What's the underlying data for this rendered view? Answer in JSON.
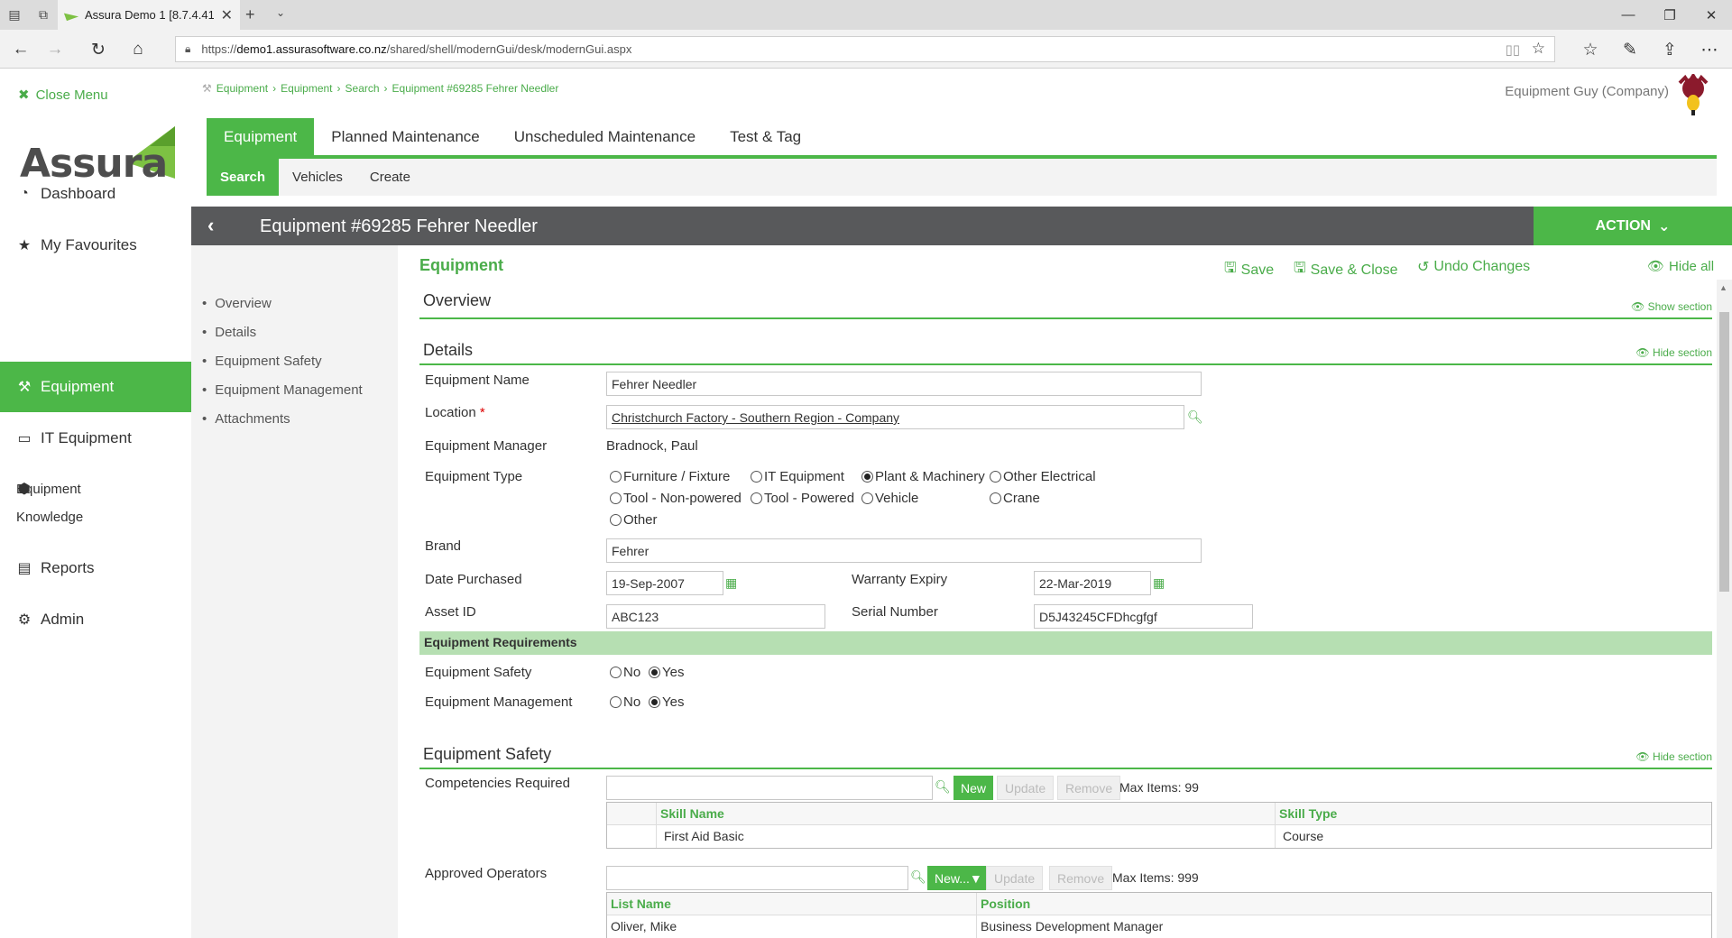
{
  "browser": {
    "tab_title": "Assura Demo 1 [8.7.4.41",
    "url_prefix": "https://",
    "url_host": "demo1.assurasoftware.co.nz",
    "url_path": "/shared/shell/modernGui/desk/modernGui.aspx"
  },
  "sidebar": {
    "close_label": "Close Menu",
    "logo_text": "Assura",
    "items": [
      {
        "label": "Dashboard",
        "icon": "dashboard-icon"
      },
      {
        "label": "My Favourites",
        "icon": "star-icon"
      },
      {
        "label": "Equipment",
        "icon": "hammer-icon",
        "active": true
      },
      {
        "label": "IT Equipment",
        "icon": "laptop-icon"
      },
      {
        "label": "Equipment Knowledge",
        "icon": "cube-icon"
      },
      {
        "label": "Reports",
        "icon": "report-icon"
      },
      {
        "label": "Admin",
        "icon": "user-cog-icon"
      }
    ]
  },
  "breadcrumb": [
    "Equipment",
    "Equipment",
    "Search",
    "Equipment #69285 Fehrer Needler"
  ],
  "user": {
    "name": "Equipment Guy (Company)"
  },
  "main_tabs": [
    "Equipment",
    "Planned Maintenance",
    "Unscheduled Maintenance",
    "Test & Tag"
  ],
  "sub_tabs": [
    "Search",
    "Vehicles",
    "Create"
  ],
  "record": {
    "title": "Equipment #69285 Fehrer Needler",
    "action_label": "ACTION"
  },
  "section_nav": [
    "Overview",
    "Details",
    "Equipment Safety",
    "Equipment Management",
    "Attachments"
  ],
  "form": {
    "title": "Equipment",
    "save": "Save",
    "save_close": "Save & Close",
    "undo": "Undo Changes",
    "hide_all": "Hide all",
    "overview": {
      "title": "Overview",
      "toggle": "Show section"
    },
    "details": {
      "title": "Details",
      "toggle": "Hide section",
      "name_label": "Equipment Name",
      "name_value": "Fehrer Needler",
      "location_label": "Location",
      "location_value": "Christchurch Factory - Southern Region - Company",
      "manager_label": "Equipment Manager",
      "manager_value": "Bradnock, Paul",
      "type_label": "Equipment Type",
      "type_options": [
        "Furniture / Fixture",
        "IT Equipment",
        "Plant & Machinery",
        "Other Electrical",
        "Tool - Non-powered",
        "Tool - Powered",
        "Vehicle",
        "Crane",
        "Other"
      ],
      "type_selected": "Plant & Machinery",
      "brand_label": "Brand",
      "brand_value": "Fehrer",
      "purchased_label": "Date Purchased",
      "purchased_value": "19-Sep-2007",
      "warranty_label": "Warranty Expiry",
      "warranty_value": "22-Mar-2019",
      "asset_label": "Asset ID",
      "asset_value": "ABC123",
      "serial_label": "Serial Number",
      "serial_value": "D5J43245CFDhcgfgf",
      "req_title": "Equipment Requirements",
      "safety_label": "Equipment Safety",
      "mgmt_label": "Equipment Management",
      "no": "No",
      "yes": "Yes"
    },
    "safety": {
      "title": "Equipment Safety",
      "toggle": "Hide section",
      "comp_label": "Competencies Required",
      "new": "New",
      "update": "Update",
      "remove": "Remove",
      "comp_max": "Max Items: 99",
      "comp_headers": [
        "",
        "Skill Name",
        "Skill Type"
      ],
      "comp_rows": [
        [
          "",
          "First Aid Basic",
          "Course"
        ]
      ],
      "ops_label": "Approved Operators",
      "ops_new": "New...▼",
      "ops_max": "Max Items: 999",
      "ops_headers": [
        "List Name",
        "Position"
      ],
      "ops_rows": [
        [
          "Oliver, Mike",
          "Business Development Manager"
        ]
      ]
    }
  },
  "colors": {
    "accent": "#4cb748",
    "header": "#58595b",
    "req_bar": "#b6dfb2"
  }
}
